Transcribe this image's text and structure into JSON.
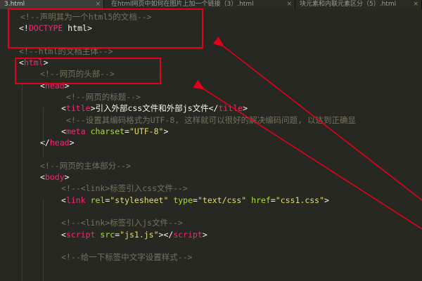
{
  "tabs": [
    {
      "label": "3.html",
      "active": true
    },
    {
      "label": "在html网页中如何在图片上加一个链接（3）.html",
      "active": false
    },
    {
      "label": "块元素和内联元素区分（5）.html",
      "active": false
    }
  ],
  "tab_close_glyph": "×",
  "code": {
    "l1": {
      "text": "<!--声明其为一个html5的文档-->"
    },
    "l2": {
      "open": "<!",
      "kw": "DOCTYPE",
      "rest": " html>"
    },
    "l4": {
      "text": "<!--html的文档主体-->"
    },
    "l5": {
      "tag": "html"
    },
    "l6": {
      "text": "<!--网页的头部-->"
    },
    "l7": {
      "tag": "head"
    },
    "l8": {
      "text": "<!--网页的标题-->"
    },
    "l9": {
      "tag": "title",
      "content": "引入外部css文件和外部js文件",
      "close": "title"
    },
    "l10": {
      "text": "<!--设置其编码格式为UTF-8, 这样就可以很好的解决编码问题, 以达到正确显"
    },
    "l11": {
      "tag": "meta",
      "attr1": "charset",
      "val1": "\"UTF-8\""
    },
    "l12": {
      "close": "head"
    },
    "l14": {
      "text": "<!--网页的主体部分-->"
    },
    "l15": {
      "tag": "body"
    },
    "l16": {
      "text": "<!--<link>标签引入css文件-->"
    },
    "l17": {
      "tag": "link",
      "attr1": "rel",
      "val1": "\"stylesheet\"",
      "attr2": "type",
      "val2": "\"text/css\"",
      "attr3": "href",
      "val3": "\"css1.css\""
    },
    "l19": {
      "text": "<!--<link>标签引入js文件-->"
    },
    "l20": {
      "tag": "script",
      "attr1": "src",
      "val1": "\"js1.js\"",
      "close": "script"
    },
    "l22": {
      "text": "<!--给一下标签中文字设置样式-->"
    }
  },
  "colors": {
    "background": "#272822",
    "comment": "#75715e",
    "tag": "#f92672",
    "attribute": "#a6e22e",
    "string": "#e6db74",
    "text": "#f8f8f2",
    "annotation": "#e3001b"
  }
}
